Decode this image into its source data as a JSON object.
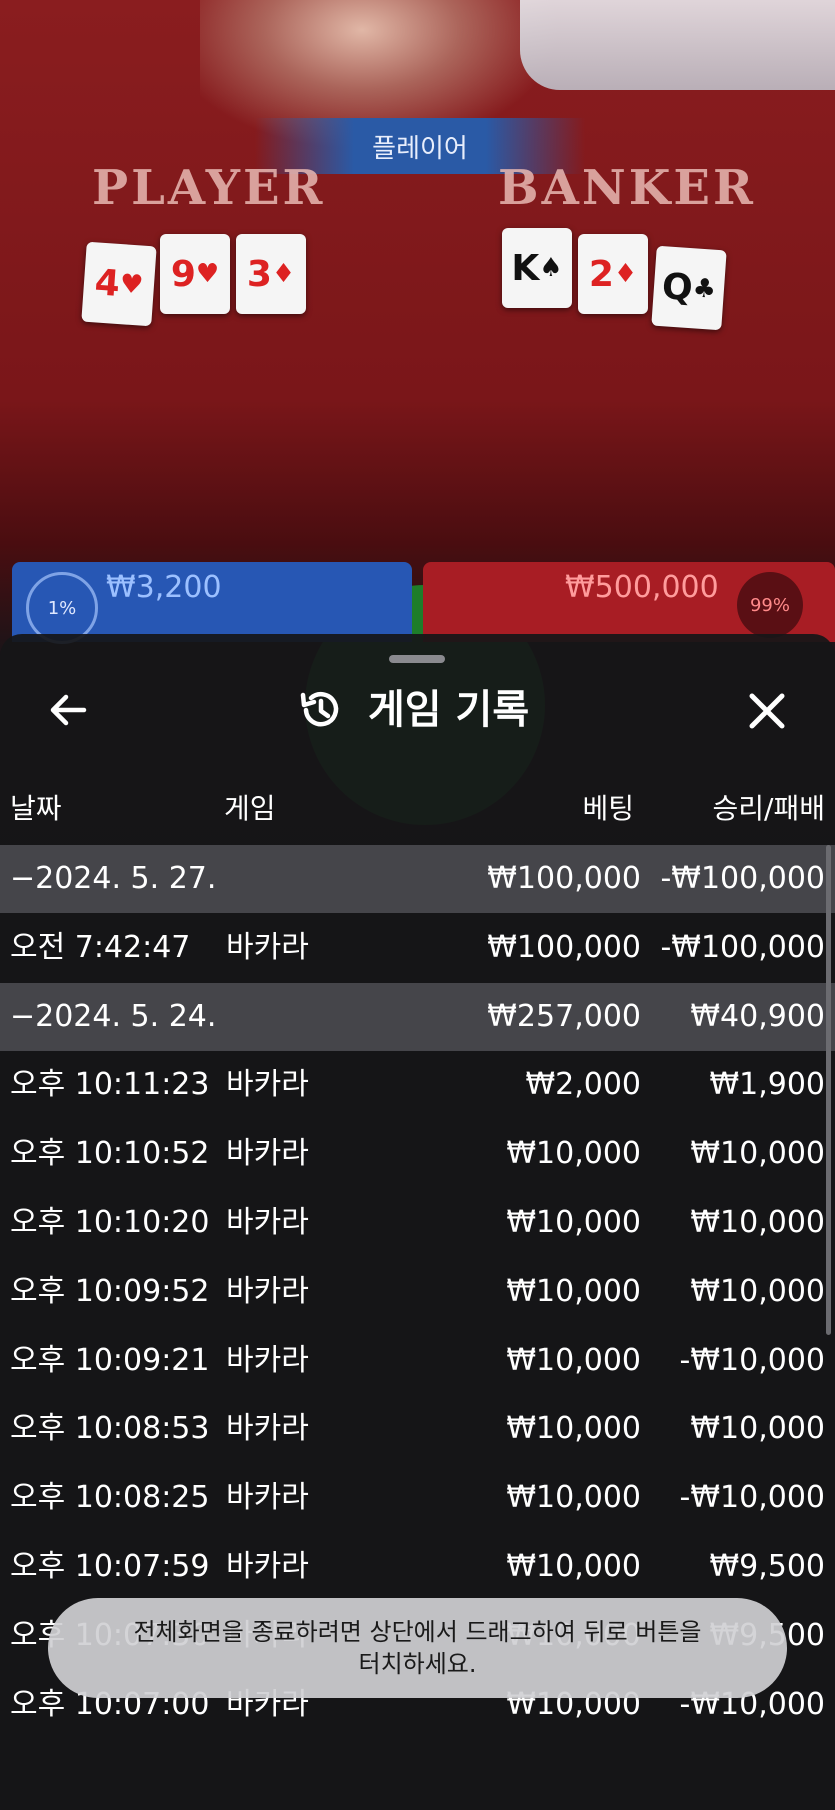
{
  "game_view": {
    "banner": "플레이어",
    "player_label": "PLAYER",
    "banker_label": "BANKER",
    "player_cards": [
      {
        "rank": "4",
        "suit": "♥",
        "color": "red"
      },
      {
        "rank": "9",
        "suit": "♥",
        "color": "red"
      },
      {
        "rank": "3",
        "suit": "♦",
        "color": "red"
      }
    ],
    "banker_cards": [
      {
        "rank": "K",
        "suit": "♠",
        "color": "black"
      },
      {
        "rank": "2",
        "suit": "♦",
        "color": "red"
      },
      {
        "rank": "Q",
        "suit": "♣",
        "color": "black"
      }
    ],
    "player_bet_pct": "1%",
    "player_bet_amount": "₩3,200",
    "banker_bet_amount": "₩500,000",
    "banker_bet_pct": "99%"
  },
  "sheet": {
    "title": "게임 기록",
    "columns": {
      "date": "날짜",
      "game": "게임",
      "bet": "베팅",
      "win_loss": "승리/패배"
    },
    "rows": [
      {
        "type": "group",
        "date": "−2024. 5. 27.",
        "game": "",
        "bet": "₩100,000",
        "win_loss": "-₩100,000"
      },
      {
        "type": "item",
        "date": "오전 7:42:47",
        "game": "바카라",
        "bet": "₩100,000",
        "win_loss": "-₩100,000"
      },
      {
        "type": "group",
        "date": "−2024. 5. 24.",
        "game": "",
        "bet": "₩257,000",
        "win_loss": "₩40,900"
      },
      {
        "type": "item",
        "date": "오후 10:11:23",
        "game": "바카라",
        "bet": "₩2,000",
        "win_loss": "₩1,900"
      },
      {
        "type": "item",
        "date": "오후 10:10:52",
        "game": "바카라",
        "bet": "₩10,000",
        "win_loss": "₩10,000"
      },
      {
        "type": "item",
        "date": "오후 10:10:20",
        "game": "바카라",
        "bet": "₩10,000",
        "win_loss": "₩10,000"
      },
      {
        "type": "item",
        "date": "오후 10:09:52",
        "game": "바카라",
        "bet": "₩10,000",
        "win_loss": "₩10,000"
      },
      {
        "type": "item",
        "date": "오후 10:09:21",
        "game": "바카라",
        "bet": "₩10,000",
        "win_loss": "-₩10,000"
      },
      {
        "type": "item",
        "date": "오후 10:08:53",
        "game": "바카라",
        "bet": "₩10,000",
        "win_loss": "₩10,000"
      },
      {
        "type": "item",
        "date": "오후 10:08:25",
        "game": "바카라",
        "bet": "₩10,000",
        "win_loss": "-₩10,000"
      },
      {
        "type": "item",
        "date": "오후 10:07:59",
        "game": "바카라",
        "bet": "₩10,000",
        "win_loss": "₩9,500"
      },
      {
        "type": "item",
        "date": "오후 10:07:30",
        "game": "바카라",
        "bet": "₩10,000",
        "win_loss": "₩9,500"
      },
      {
        "type": "item",
        "date": "오후 10:07:00",
        "game": "바카라",
        "bet": "₩10,000",
        "win_loss": "-₩10,000"
      }
    ]
  },
  "toast": {
    "line1": "전체화면을 종료하려면 상단에서 드래그하여 뒤로 버튼을",
    "line2": "터치하세요."
  },
  "icons": {
    "back": "arrow-left-icon",
    "history": "history-icon",
    "close": "close-icon"
  }
}
